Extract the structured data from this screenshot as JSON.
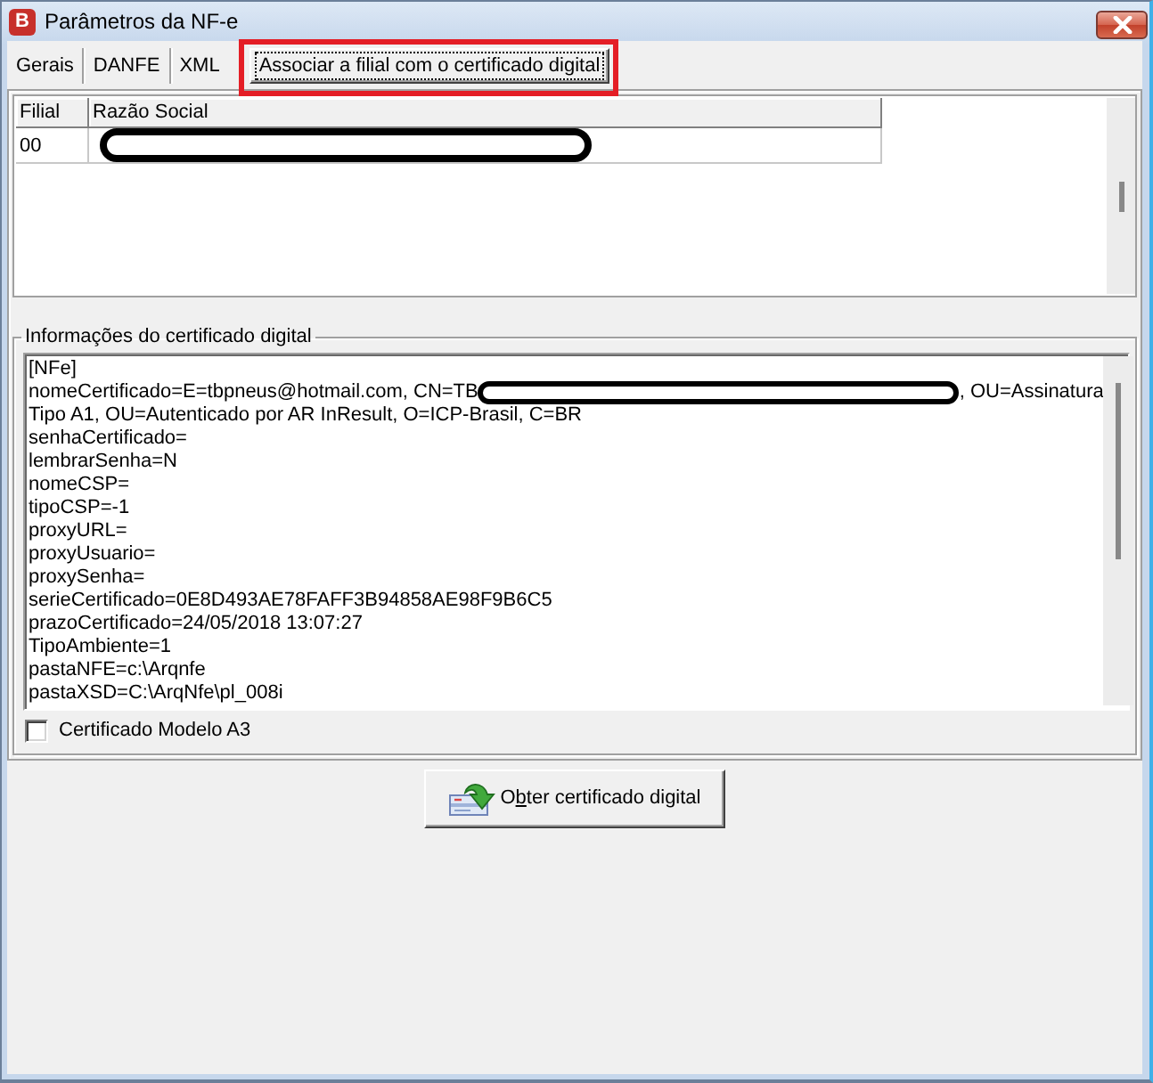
{
  "window": {
    "icon_letter": "B",
    "title": "Parâmetros da NF-e"
  },
  "tabs": [
    {
      "label": "Gerais",
      "selected": false,
      "highlighted": false
    },
    {
      "label": "DANFE",
      "selected": false,
      "highlighted": false
    },
    {
      "label": "XML",
      "selected": false,
      "highlighted": false
    },
    {
      "label": "Associar a filial com o certificado digital",
      "selected": true,
      "highlighted": true
    }
  ],
  "branch_grid": {
    "columns": [
      "Filial",
      "Razão Social"
    ],
    "rows": [
      {
        "cells": [
          {
            "text": "00",
            "redacted": false
          },
          {
            "redacted": true
          }
        ]
      }
    ]
  },
  "certificate_group": {
    "title": "Informações do certificado digital",
    "lines": [
      {
        "text": "[NFe]",
        "redacted": false
      },
      {
        "text": "nomeCertificado=E=tbpneus@hotmail.com, CN=TB",
        "redacted": true,
        "text_after": ", OU=Assinatura"
      },
      {
        "text": "Tipo A1, OU=Autenticado por AR InResult, O=ICP-Brasil, C=BR",
        "redacted": false
      },
      {
        "text": "senhaCertificado=",
        "redacted": false
      },
      {
        "text": "lembrarSenha=N",
        "redacted": false
      },
      {
        "text": "nomeCSP=",
        "redacted": false
      },
      {
        "text": "tipoCSP=-1",
        "redacted": false
      },
      {
        "text": "proxyURL=",
        "redacted": false
      },
      {
        "text": "proxyUsuario=",
        "redacted": false
      },
      {
        "text": "proxySenha=",
        "redacted": false
      },
      {
        "text": "serieCertificado=0E8D493AE78FAFF3B94858AE98F9B6C5",
        "redacted": false
      },
      {
        "text": "prazoCertificado=24/05/2018 13:07:27",
        "redacted": false
      },
      {
        "text": "TipoAmbiente=1",
        "redacted": false
      },
      {
        "text": "pastaNFE=c:\\Arqnfe",
        "redacted": false
      },
      {
        "text": "pastaXSD=C:\\ArqNfe\\pl_008i",
        "redacted": false
      }
    ],
    "checkbox": {
      "label": "Certificado Modelo A3",
      "checked": false
    }
  },
  "button": {
    "label_before": "O",
    "access_key": "b",
    "label_after": "ter certificado digital"
  }
}
